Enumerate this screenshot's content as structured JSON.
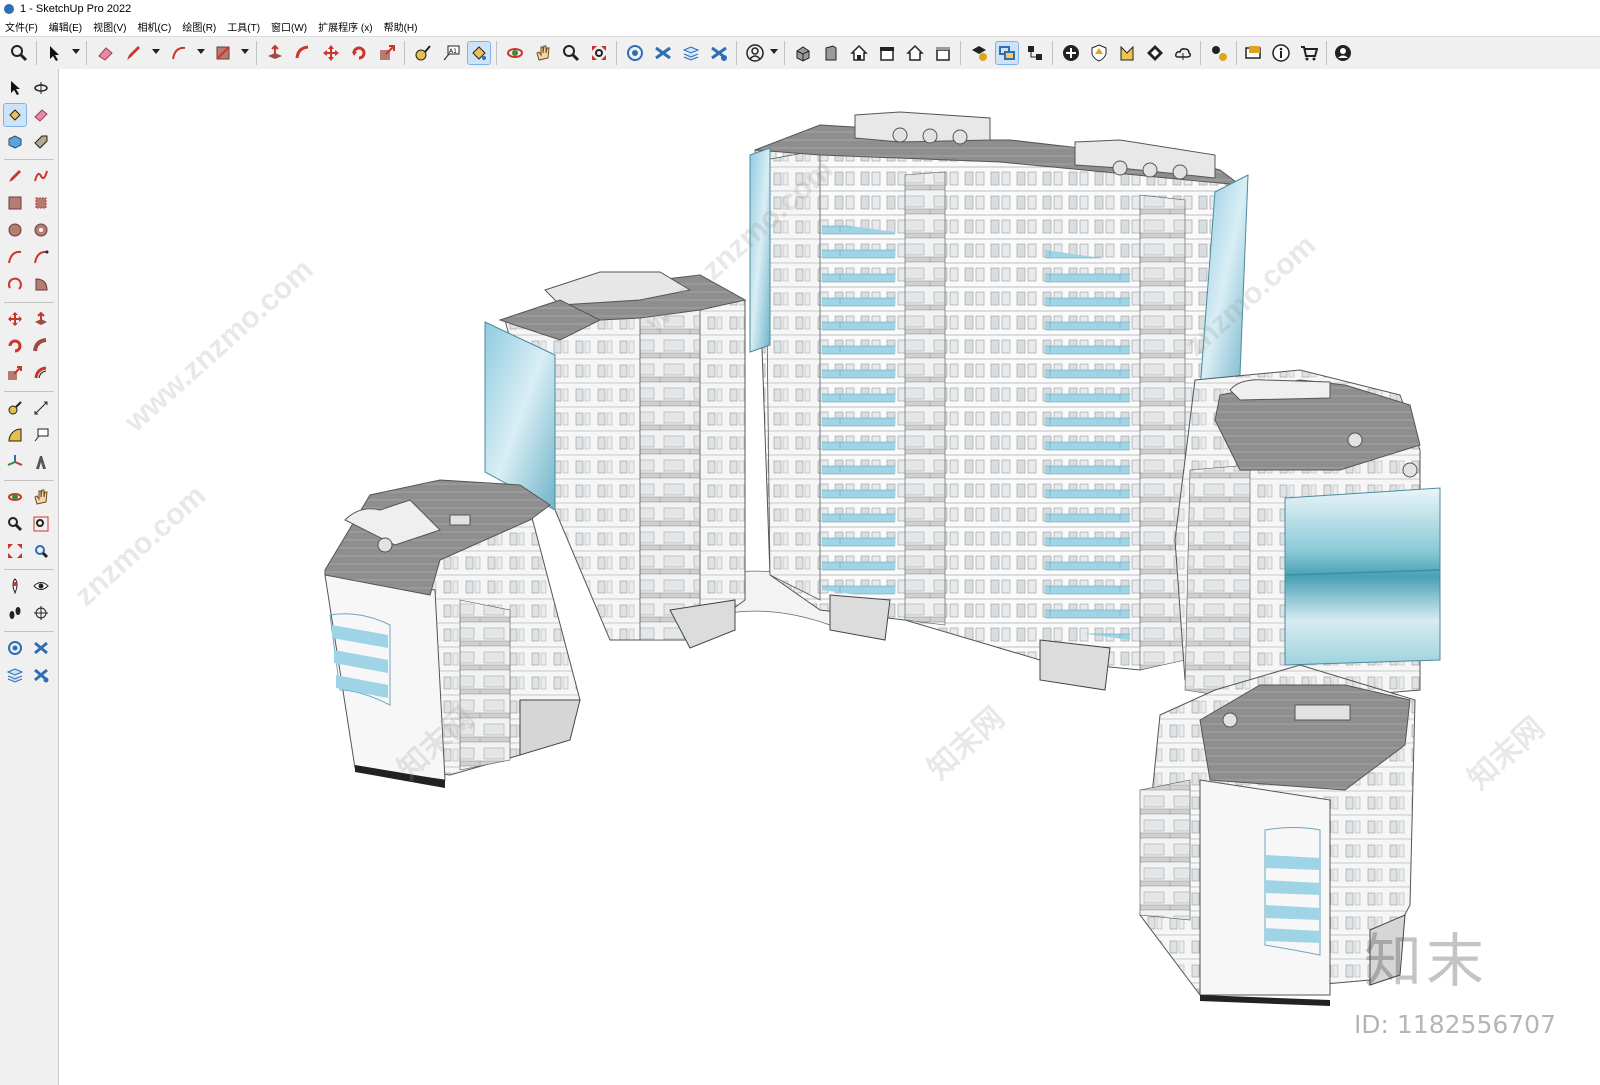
{
  "window": {
    "title": "1 - SketchUp Pro 2022"
  },
  "menu": [
    "文件(F)",
    "编辑(E)",
    "视图(V)",
    "相机(C)",
    "绘图(R)",
    "工具(T)",
    "窗口(W)",
    "扩展程序 (x)",
    "帮助(H)"
  ],
  "toolbar_icons": [
    "zoom-icon",
    "select-icon",
    "eraser-icon",
    "pencil-icon",
    "arc-icon",
    "rectangle-icon",
    "push-pull-icon",
    "follow-me-icon",
    "move-icon",
    "rotate-icon",
    "scale-icon",
    "tape-measure-icon",
    "text-icon",
    "paint-bucket-icon",
    "orbit-icon",
    "pan-icon",
    "zoom-window-icon",
    "zoom-extents-icon",
    "section-plane-icon",
    "section-cut-icon",
    "section-fill-icon",
    "section-display-icon",
    "account-icon",
    "iso-view-icon",
    "front-view-icon",
    "top-view-icon",
    "right-view-icon",
    "back-view-icon",
    "left-view-icon",
    "warehouse-icon",
    "component-icon",
    "outliner-icon",
    "layers-icon",
    "add-location-icon",
    "shadow-icon",
    "style-icon",
    "sandbox-icon",
    "cloud-icon",
    "extension-icon",
    "message-icon",
    "info-icon",
    "cart-icon",
    "user-icon"
  ],
  "side_icons": [
    "select-icon",
    "orbit-icon",
    "paint-bucket-icon",
    "eraser-icon",
    "component-icon",
    "tag-icon",
    "line-icon",
    "freehand-icon",
    "rectangle-icon",
    "rotated-rectangle-icon",
    "circle-icon",
    "polygon-icon",
    "arc-icon",
    "two-point-arc-icon",
    "three-point-arc-icon",
    "pie-icon",
    "move-icon",
    "push-pull-icon",
    "rotate-icon",
    "follow-me-icon",
    "scale-icon",
    "offset-icon",
    "tape-measure-icon",
    "dimension-icon",
    "protractor-icon",
    "text-icon",
    "axes-icon",
    "3d-text-icon",
    "orbit-icon",
    "pan-icon",
    "zoom-icon",
    "zoom-window-icon",
    "zoom-extents-icon",
    "previous-view-icon",
    "position-camera-icon",
    "look-around-icon",
    "walk-icon",
    "section-plane-icon",
    "section-display-icon",
    "section-cut-icon",
    "section-fill-icon",
    "section-toggle-icon"
  ],
  "watermarks": [
    "www.znzmo.com",
    "知末网",
    "znzmo.com"
  ],
  "brand_logo": "知末",
  "image_id": "ID: 1182556707",
  "colors": {
    "accent": "#2f6db5",
    "glass": "#8fcbe0",
    "roof": "#8e8e8e",
    "wall": "#f4f4f4"
  }
}
